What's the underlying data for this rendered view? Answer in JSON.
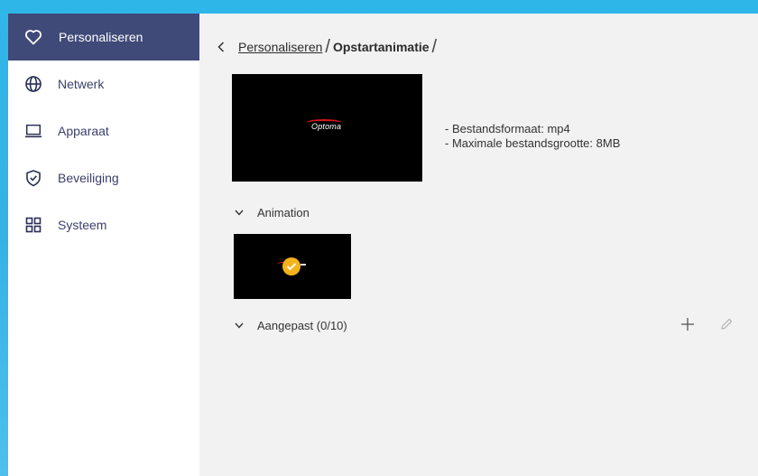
{
  "sidebar": {
    "items": [
      {
        "label": "Personaliseren",
        "icon": "heart-icon",
        "active": true
      },
      {
        "label": "Netwerk",
        "icon": "globe-icon",
        "active": false
      },
      {
        "label": "Apparaat",
        "icon": "laptop-icon",
        "active": false
      },
      {
        "label": "Beveiliging",
        "icon": "shield-check-icon",
        "active": false
      },
      {
        "label": "Systeem",
        "icon": "grid-icon",
        "active": false
      }
    ]
  },
  "breadcrumb": {
    "parent": "Personaliseren",
    "current": "Opstartanimatie",
    "separator": "/"
  },
  "preview": {
    "logo_text": "Optoma"
  },
  "info": {
    "line1": "- Bestandsformaat: mp4",
    "line2": "- Maximale bestandsgrootte: 8MB"
  },
  "sections": {
    "animation": {
      "label": "Animation"
    },
    "custom": {
      "label": "Aangepast (0/10)"
    }
  },
  "colors": {
    "accent": "#3f4a78",
    "check": "#f5b21a",
    "brand_red": "#d9151d",
    "frame": "#2fb6e9"
  }
}
